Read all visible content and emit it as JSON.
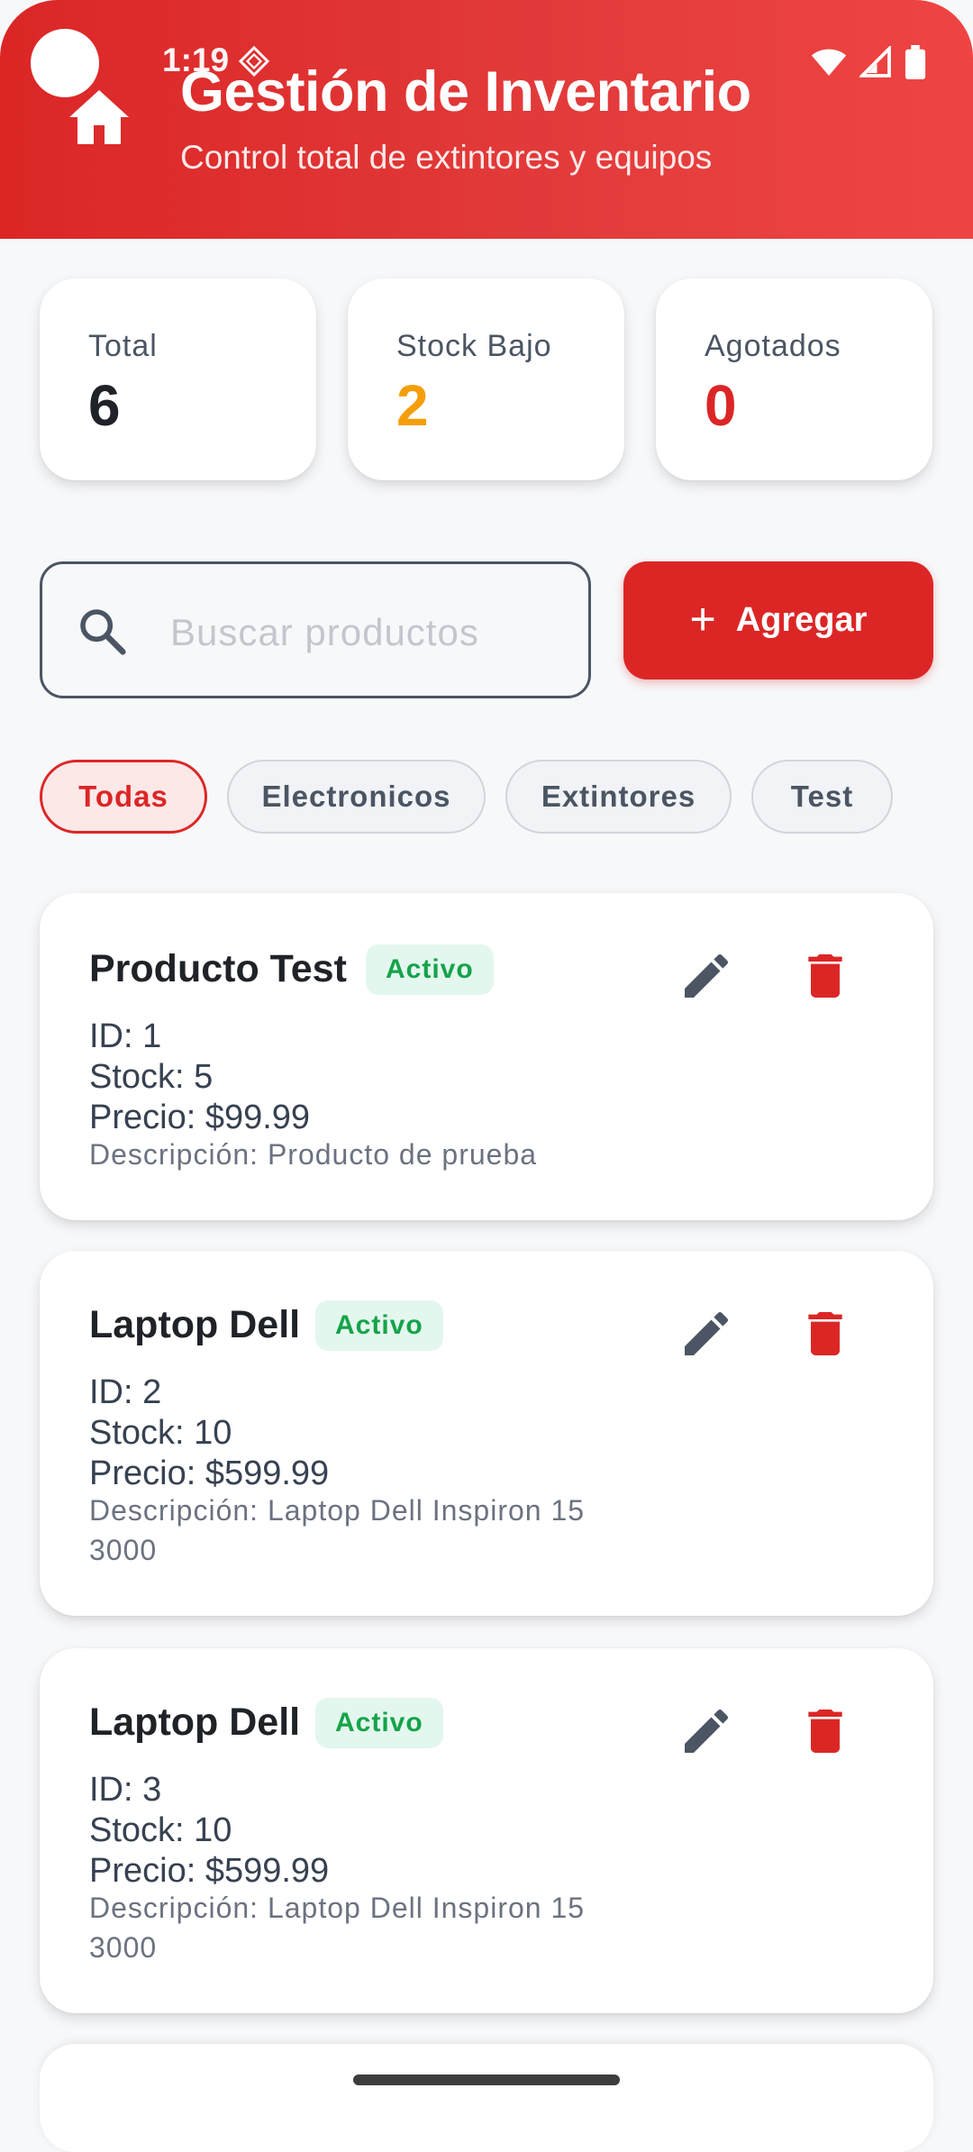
{
  "status_bar": {
    "time": "1:19"
  },
  "header": {
    "title": "Gestión de Inventario",
    "subtitle": "Control total de extintores y equipos"
  },
  "stats": [
    {
      "label": "Total",
      "value": "6",
      "color": "#1f2328"
    },
    {
      "label": "Stock Bajo",
      "value": "2",
      "color": "#f59e0b"
    },
    {
      "label": "Agotados",
      "value": "0",
      "color": "#dc2626"
    }
  ],
  "search": {
    "placeholder": "Buscar productos",
    "value": ""
  },
  "add_button": {
    "label": "Agregar"
  },
  "categories": [
    {
      "label": "Todas",
      "selected": true
    },
    {
      "label": "Electronicos",
      "selected": false
    },
    {
      "label": "Extintores",
      "selected": false
    },
    {
      "label": "Test",
      "selected": false
    }
  ],
  "products": [
    {
      "name": "Producto Test",
      "status": "Activo",
      "id": "ID: 1",
      "stock": "Stock: 5",
      "price": "Precio: $99.99",
      "description": "Descripción: Producto de prueba"
    },
    {
      "name": "Laptop Dell",
      "status": "Activo",
      "id": "ID: 2",
      "stock": "Stock: 10",
      "price": "Precio: $599.99",
      "description": "Descripción: Laptop Dell Inspiron 15 3000"
    },
    {
      "name": "Laptop Dell",
      "status": "Activo",
      "id": "ID: 3",
      "stock": "Stock: 10",
      "price": "Precio: $599.99",
      "description": "Descripción: Laptop Dell Inspiron 15 3000"
    }
  ],
  "colors": {
    "primary": "#dc2626",
    "success": "#16a34a",
    "warning": "#f59e0b",
    "icon_gray": "#4b5563"
  },
  "icons": [
    "home-icon",
    "search-icon",
    "plus-icon",
    "edit-icon",
    "trash-icon",
    "wifi-icon",
    "signal-icon",
    "battery-icon"
  ]
}
